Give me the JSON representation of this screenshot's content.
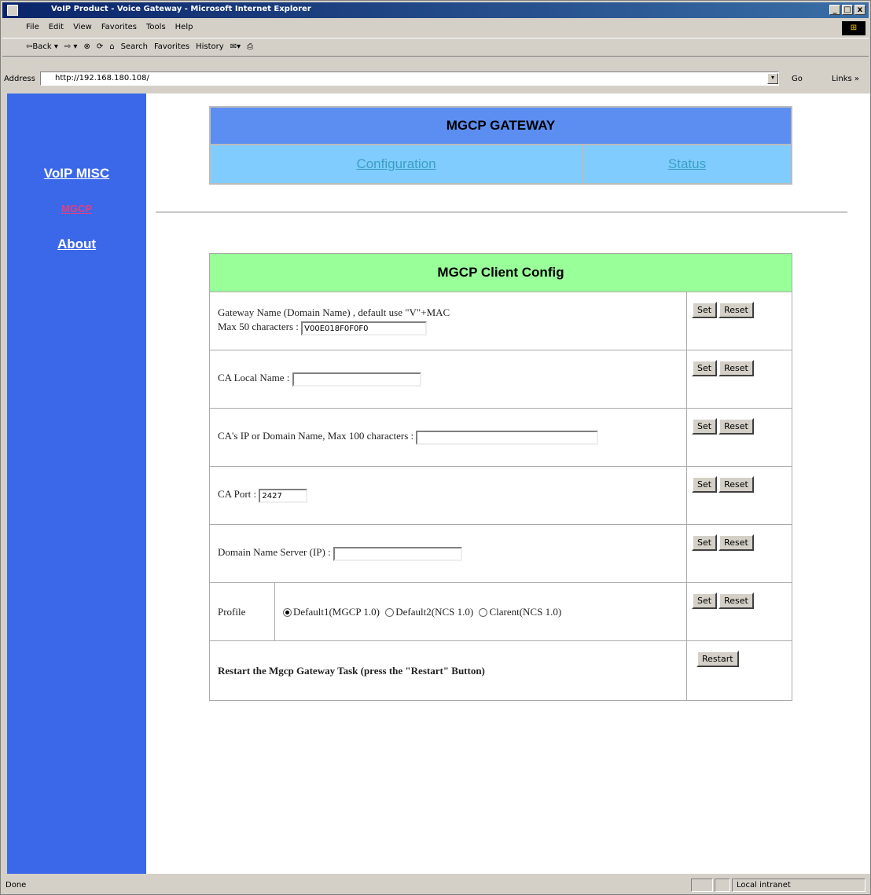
{
  "window": {
    "title": "VoIP Product - Voice Gateway - Microsoft Internet Explorer",
    "min": "_",
    "max": "□",
    "close": "x"
  },
  "menu": [
    "File",
    "Edit",
    "View",
    "Favorites",
    "Tools",
    "Help"
  ],
  "toolbar": [
    "⇦Back ▾",
    "⇨ ▾",
    "⊗",
    "⟳",
    "⌂",
    "Search",
    "Favorites",
    "History",
    "✉▾",
    "⎙"
  ],
  "address": {
    "label": "Address",
    "value": "http://192.168.180.108/",
    "go": "Go",
    "links": "Links »"
  },
  "sidebar": {
    "items": [
      {
        "label": "VoIP MISC",
        "color": "#ffffff"
      },
      {
        "label": "MGCP",
        "color": "#e04080"
      },
      {
        "label": "About",
        "color": "#ffffff"
      }
    ]
  },
  "header": {
    "title": "MGCP GATEWAY",
    "tabs": [
      "Configuration",
      "Status"
    ]
  },
  "config": {
    "title": "MGCP Client Config",
    "gateway_line1": "Gateway Name (Domain Name) , default use \"V\"+MAC",
    "gateway_line2": "Max 50 characters :",
    "gateway_value": "V00E018F0F0F0",
    "ca_local_label": "CA Local Name :",
    "ca_local_value": "",
    "ca_ip_label": "CA's IP or Domain Name, Max 100 characters :",
    "ca_ip_value": "",
    "ca_port_label": "CA Port :",
    "ca_port_value": "2427",
    "dns_label": "Domain Name Server (IP) :",
    "dns_value": "",
    "profile_label": "Profile",
    "profile_options": [
      "Default1(MGCP 1.0)",
      "Default2(NCS 1.0)",
      "Clarent(NCS 1.0)"
    ],
    "profile_selected": "Default1(MGCP 1.0)",
    "restart_text": "Restart the Mgcp Gateway Task (press the \"Restart\" Button)",
    "set_label": "Set",
    "reset_label": "Reset",
    "restart_label": "Restart"
  },
  "status": {
    "text": "Done",
    "zone": "Local intranet"
  }
}
